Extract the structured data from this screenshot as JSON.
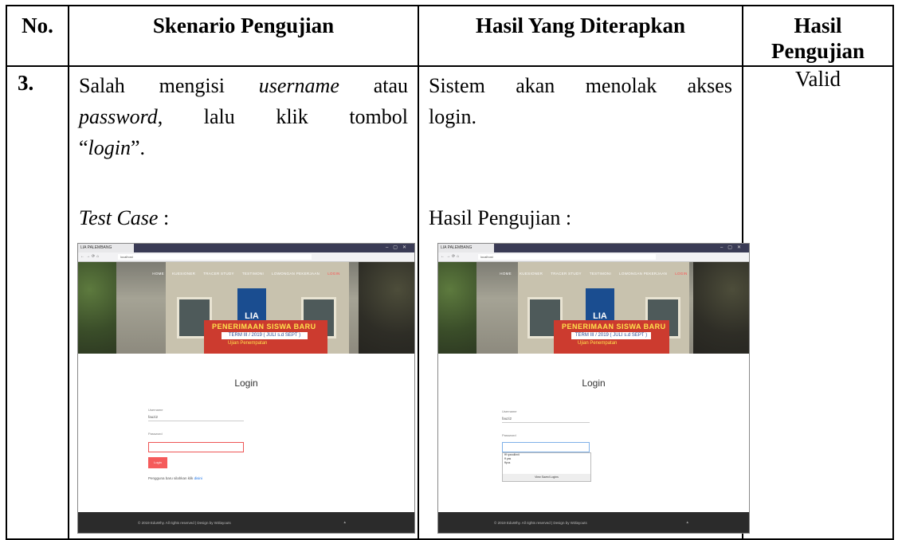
{
  "headers": {
    "no": "No.",
    "skenario": "Skenario Pengujian",
    "hasil_diterapkan": "Hasil Yang Diterapkan",
    "hasil_pengujian_l1": "Hasil",
    "hasil_pengujian_l2": "Pengujian"
  },
  "row": {
    "no": "3.",
    "skenario": {
      "w1": "Salah",
      "w2": "mengisi",
      "w3_italic": "username",
      "w4": "atau",
      "w5_italic": "password",
      "w5_suffix": ",",
      "w6": "lalu",
      "w7": "klik",
      "w8": "tombol",
      "quote_open": "“",
      "login_italic": "login",
      "quote_close": "”.",
      "test_case_italic": "Test Case",
      "test_case_suffix": " :"
    },
    "hasil_diterapkan": {
      "line1_w1": "Sistem",
      "line1_w2": "akan",
      "line1_w3": "menolak",
      "line1_w4": "akses",
      "line2": "login.",
      "hasil_label": "Hasil Pengujian :"
    },
    "hasil_pengujian": "Valid"
  },
  "screenshot": {
    "tab_title": "LIA PALEMBANG",
    "nav": [
      "HOME",
      "KUESIONER",
      "TRACER STUDY",
      "TESTIMONI",
      "LOWONGAN PEKERJAAN",
      "LOGIN"
    ],
    "logo_text": "LIA",
    "banner_title": "PENERIMAAN SISWA BARU",
    "banner_sub": "TERM III / 2019 ( JULI s.d SEPT )",
    "banner_note": "Ujian Penempatan",
    "login_title": "Login",
    "username_label": "Username",
    "username_value": "fauzi2",
    "password_label": "Password",
    "login_button": "Login",
    "register_text": "Pengguna baru silahkan klik",
    "register_link": "disini",
    "footer_text": "© 2019 EduWhy. All rights reserved | Design by W3layouts",
    "dropdown_options": [
      "fff ryandlimit",
      "ff yas",
      "ffyus"
    ],
    "dropdown_footer": "View Saved Logins"
  }
}
